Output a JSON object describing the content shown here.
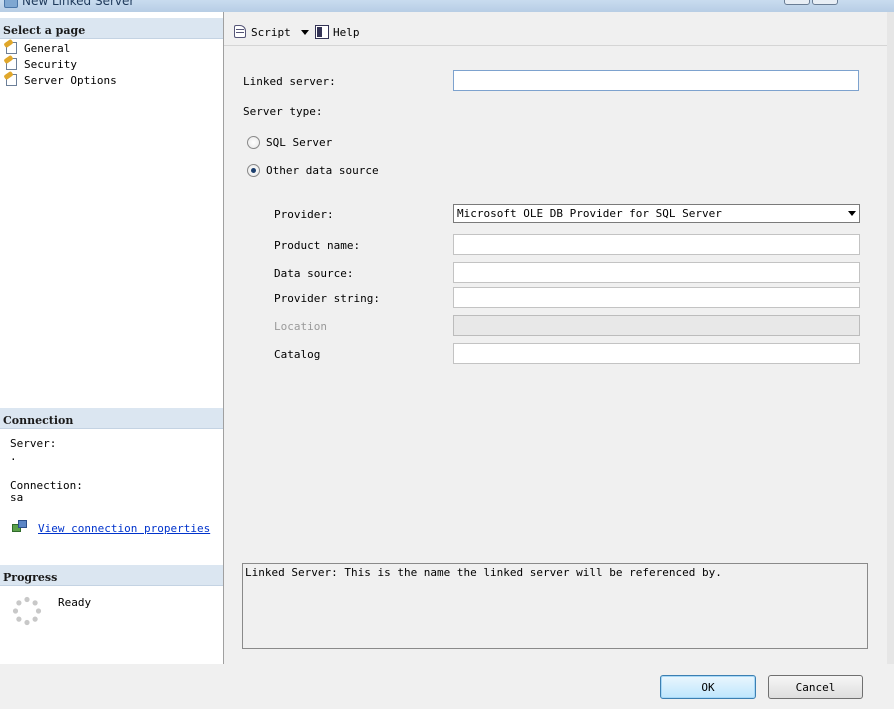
{
  "window": {
    "title": "New Linked Server"
  },
  "left": {
    "select_page_header": "Select a page",
    "pages": [
      {
        "label": "General",
        "icon": "page-settings-icon"
      },
      {
        "label": "Security",
        "icon": "page-settings-icon"
      },
      {
        "label": "Server Options",
        "icon": "page-settings-icon"
      }
    ],
    "connection_header": "Connection",
    "server_label": "Server:",
    "server_value": ".",
    "connection_label": "Connection:",
    "connection_value": "sa",
    "view_properties_link": "View connection properties",
    "progress_header": "Progress",
    "progress_status": "Ready"
  },
  "toolbar": {
    "script_label": "Script",
    "help_label": "Help"
  },
  "form": {
    "linked_server_label": "Linked server:",
    "linked_server_value": "",
    "server_type_label": "Server type:",
    "radio_sql_server": "SQL Server",
    "radio_other": "Other data source",
    "selected_server_type": "Other data source",
    "provider_label": "Provider:",
    "provider_value": "Microsoft OLE DB Provider for SQL Server",
    "product_name_label": "Product name:",
    "product_name_value": "",
    "data_source_label": "Data source:",
    "data_source_value": "",
    "provider_string_label": "Provider string:",
    "provider_string_value": "",
    "location_label": "Location",
    "location_value": "",
    "catalog_label": "Catalog",
    "catalog_value": ""
  },
  "description": "Linked Server: This is the name the linked server will be referenced by.",
  "buttons": {
    "ok": "OK",
    "cancel": "Cancel"
  },
  "colors": {
    "header_bg": "#dbe6f1",
    "link": "#0033cc",
    "ok_border": "#3c7fb1"
  }
}
